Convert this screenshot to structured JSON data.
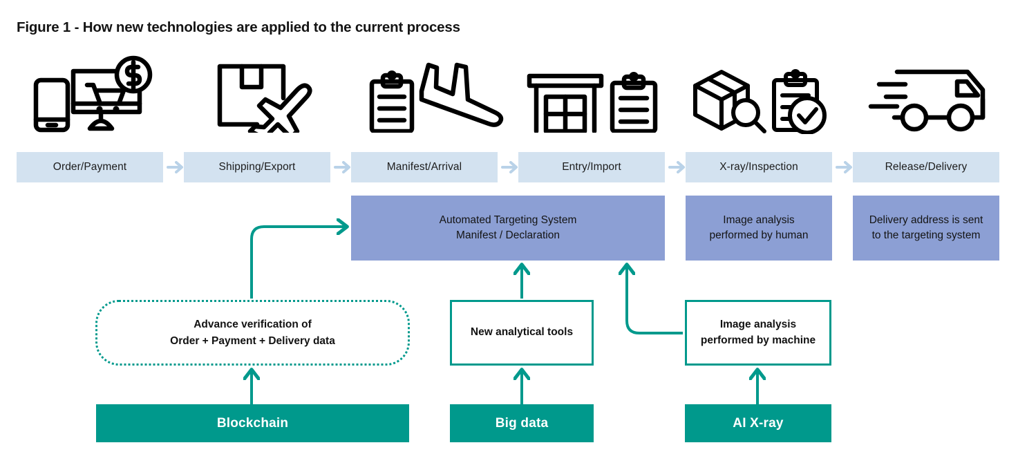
{
  "figure": {
    "title": "Figure 1 - How new technologies are applied to the current process"
  },
  "colors": {
    "stage_fill": "#d3e2f0",
    "stage_arrow": "#b9d2e8",
    "purple_fill": "#8c9fd4",
    "teal": "#00998c",
    "icon_stroke": "#000000",
    "text_dark": "#141414",
    "white": "#ffffff"
  },
  "process_stages": [
    {
      "id": "order-payment",
      "label": "Order/Payment",
      "icon": "ecommerce-order-icon"
    },
    {
      "id": "shipping-export",
      "label": "Shipping/Export",
      "icon": "parcel-airplane-icon"
    },
    {
      "id": "manifest-arrival",
      "label": "Manifest/Arrival",
      "icon": "clipboard-landing-plane-icon"
    },
    {
      "id": "entry-import",
      "label": "Entry/Import",
      "icon": "customs-building-clipboard-icon"
    },
    {
      "id": "xray-inspection",
      "label": "X-ray/Inspection",
      "icon": "parcel-magnifier-clipboard-check-icon"
    },
    {
      "id": "release-delivery",
      "label": "Release/Delivery",
      "icon": "delivery-truck-icon"
    }
  ],
  "current_process_boxes": [
    {
      "id": "automated-targeting-system",
      "line1": "Automated Targeting System",
      "line2": "Manifest / Declaration",
      "text": "Automated Targeting System\nManifest / Declaration"
    },
    {
      "id": "image-analysis-human",
      "line1": "Image analysis",
      "line2": "performed by human",
      "text": "Image analysis\nperformed by human"
    },
    {
      "id": "delivery-address-targeting",
      "line1": "Delivery address is sent",
      "line2": "to the targeting system",
      "text": "Delivery address is sent\nto the targeting system"
    }
  ],
  "new_capability_boxes": [
    {
      "id": "advance-verification",
      "style": "dotted",
      "line1": "Advance verification of",
      "line2": "Order + Payment + Delivery data",
      "text": "Advance verification of\nOrder + Payment + Delivery data"
    },
    {
      "id": "new-analytical-tools",
      "style": "outline",
      "line1": "New analytical tools",
      "line2": "",
      "text": "New analytical tools"
    },
    {
      "id": "image-analysis-machine",
      "style": "outline",
      "line1": "Image analysis",
      "line2": "performed by machine",
      "text": "Image analysis\nperformed by machine"
    }
  ],
  "technologies": [
    {
      "id": "blockchain",
      "label": "Blockchain"
    },
    {
      "id": "big-data",
      "label": "Big data"
    },
    {
      "id": "ai-xray",
      "label": "AI X-ray"
    }
  ],
  "connectors": [
    {
      "from": "blockchain",
      "to": "advance-verification",
      "kind": "straight-arrow-up"
    },
    {
      "from": "advance-verification",
      "to": "automated-targeting-system",
      "kind": "elbow-arrow-up-right"
    },
    {
      "from": "big-data",
      "to": "new-analytical-tools",
      "kind": "straight-arrow-up"
    },
    {
      "from": "new-analytical-tools",
      "to": "automated-targeting-system",
      "kind": "straight-arrow-up"
    },
    {
      "from": "ai-xray",
      "to": "image-analysis-machine",
      "kind": "straight-arrow-up"
    },
    {
      "from": "image-analysis-machine",
      "to": "automated-targeting-system",
      "kind": "elbow-arrow-left-up"
    }
  ]
}
